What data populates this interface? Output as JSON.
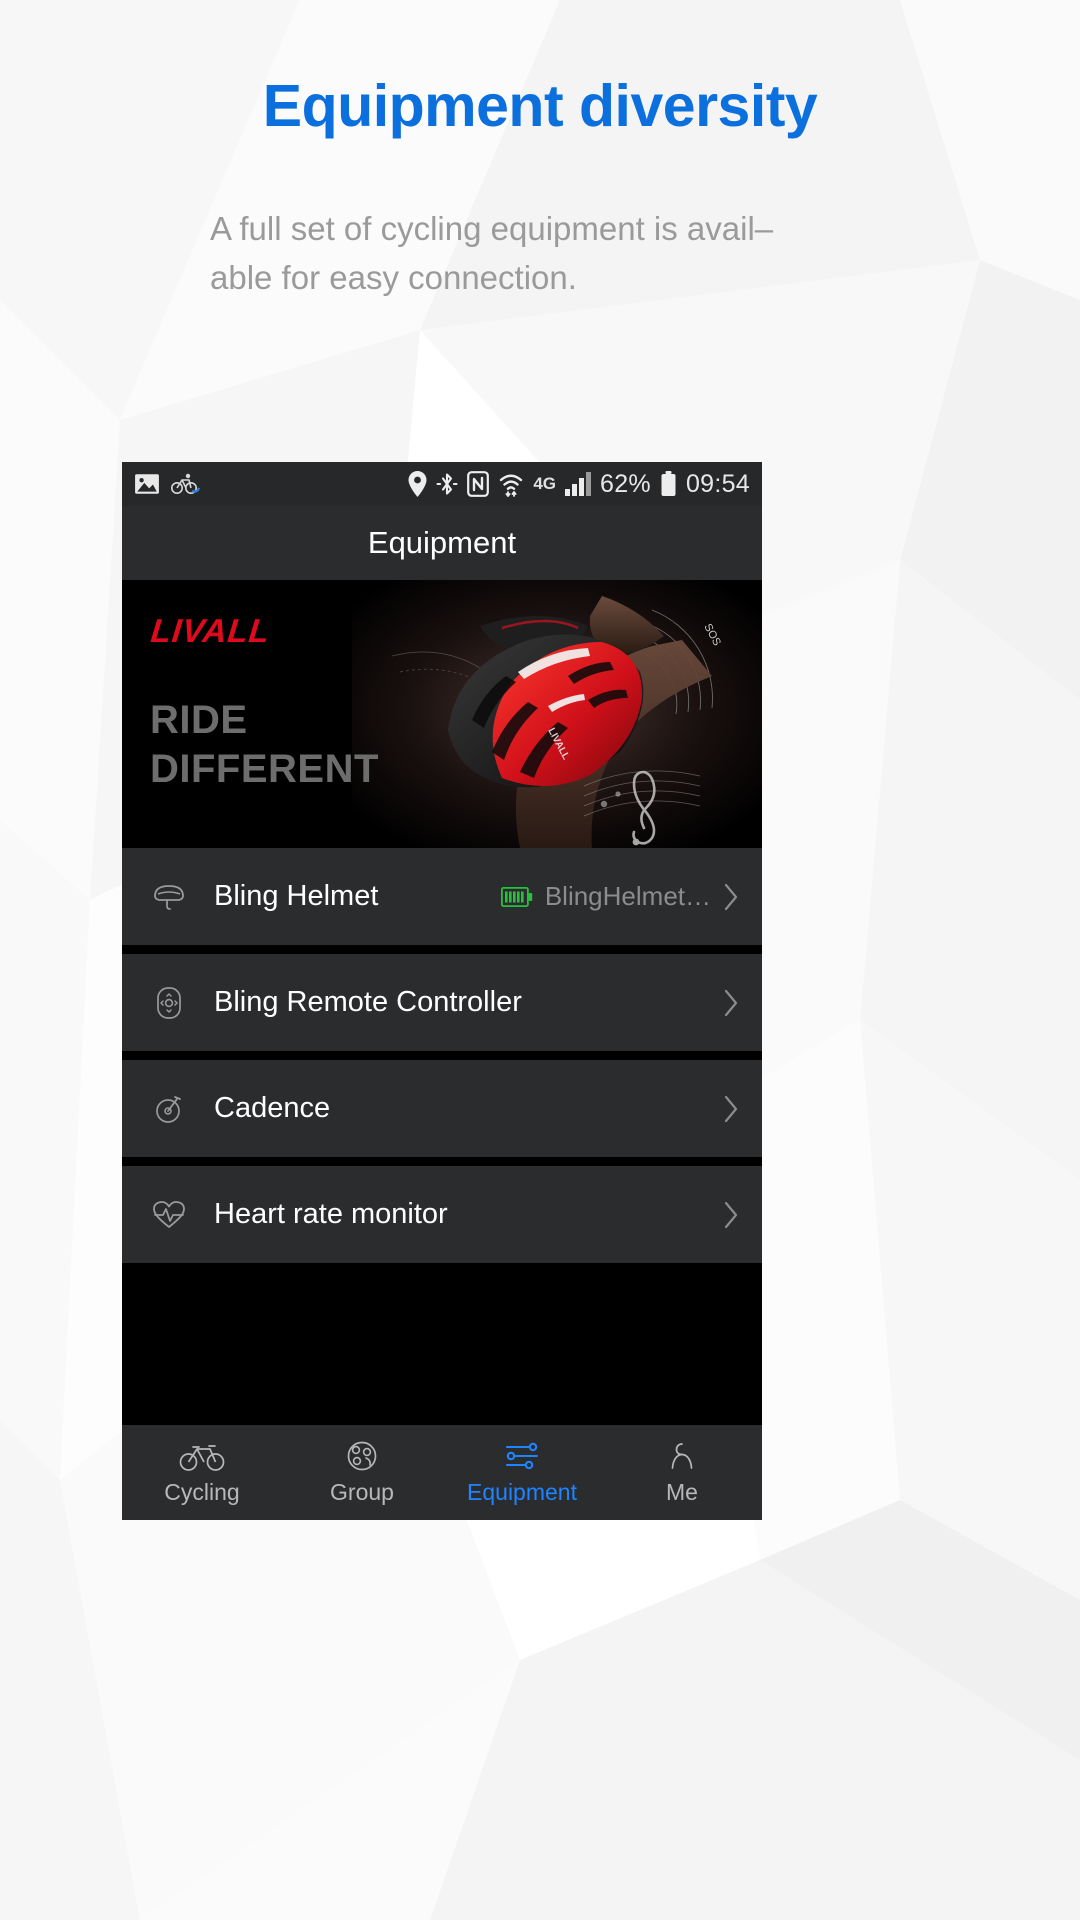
{
  "promo": {
    "title": "Equipment diversity",
    "subtitle_line1": "A full set of cycling equipment is avail–",
    "subtitle_line2": "able for easy connection.",
    "title_color": "#0b6fdd",
    "subtitle_color": "#9a9a9a"
  },
  "phone": {
    "status_bar": {
      "left_icons": [
        "image-icon",
        "cycling-notification-icon"
      ],
      "right_icons": [
        "location-pin-icon",
        "bluetooth-icon",
        "nfc-icon",
        "wifi-icon"
      ],
      "network": "4G",
      "signal_icon": "signal-bars-icon",
      "battery_percent": "62%",
      "battery_icon": "battery-icon",
      "time": "09:54"
    },
    "header": {
      "title": "Equipment"
    },
    "banner": {
      "brand": "LIVALL",
      "brand_color": "#e00a1e",
      "tagline_line1": "RIDE",
      "tagline_line2": "DIFFERENT",
      "tagline_color": "#6d6d6d",
      "art_label": "livall-smart-helmet-photo",
      "art_annotations": [
        "SOS"
      ]
    },
    "devices": [
      {
        "icon": "helmet-icon",
        "label": "Bling Helmet",
        "battery_icon": "battery-full-green-icon",
        "status": "BlingHelmet…",
        "chevron": "chevron-right-icon",
        "connected": true
      },
      {
        "icon": "remote-controller-icon",
        "label": "Bling Remote Controller",
        "status": "",
        "chevron": "chevron-right-icon",
        "connected": false
      },
      {
        "icon": "cadence-icon",
        "label": "Cadence",
        "status": "",
        "chevron": "chevron-right-icon",
        "connected": false
      },
      {
        "icon": "heart-rate-icon",
        "label": "Heart rate monitor",
        "status": "",
        "chevron": "chevron-right-icon",
        "connected": false
      }
    ],
    "tabs": [
      {
        "icon": "bicycle-icon",
        "label": "Cycling",
        "active": false
      },
      {
        "icon": "group-icon",
        "label": "Group",
        "active": false
      },
      {
        "icon": "sliders-icon",
        "label": "Equipment",
        "active": true
      },
      {
        "icon": "person-icon",
        "label": "Me",
        "active": false
      }
    ],
    "active_tab_color": "#1f84ff",
    "inactive_tab_color": "#b8b8b8"
  }
}
